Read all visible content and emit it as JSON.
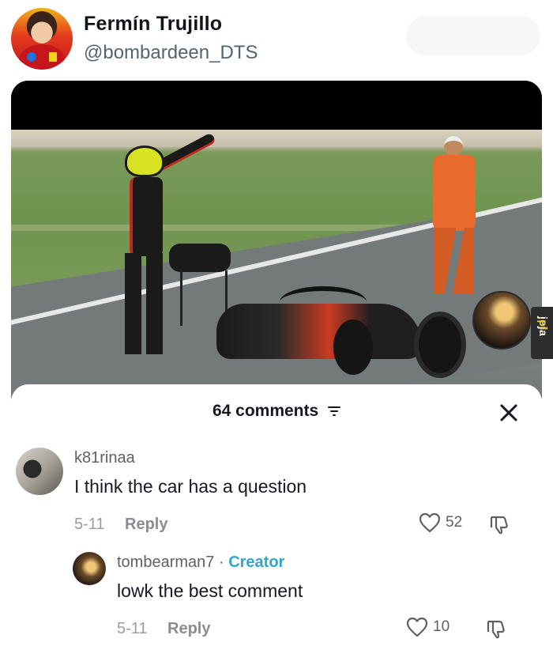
{
  "tweet": {
    "display_name": "Fermín Trujillo",
    "handle": "@bombardeen_DTS",
    "avatar_icon": "profile-avatar"
  },
  "watermark": {
    "brand": "jeja",
    "tld": ".pl"
  },
  "comments_sheet": {
    "title": "64 comments",
    "filter_icon": "filter-icon",
    "close_icon": "close-icon",
    "comments": [
      {
        "username": "k81rinaa",
        "text": "I think the car has a question",
        "date": "5-11",
        "reply_label": "Reply",
        "likes": "52"
      },
      {
        "username": "tombearman7",
        "separator": " · ",
        "badge": "Creator",
        "text": "lowk the best comment",
        "date": "5-11",
        "reply_label": "Reply",
        "likes": "10"
      }
    ]
  },
  "colors": {
    "creator_badge": "#2ea8c9",
    "text_primary": "#161823",
    "text_secondary": "#5e6066"
  }
}
